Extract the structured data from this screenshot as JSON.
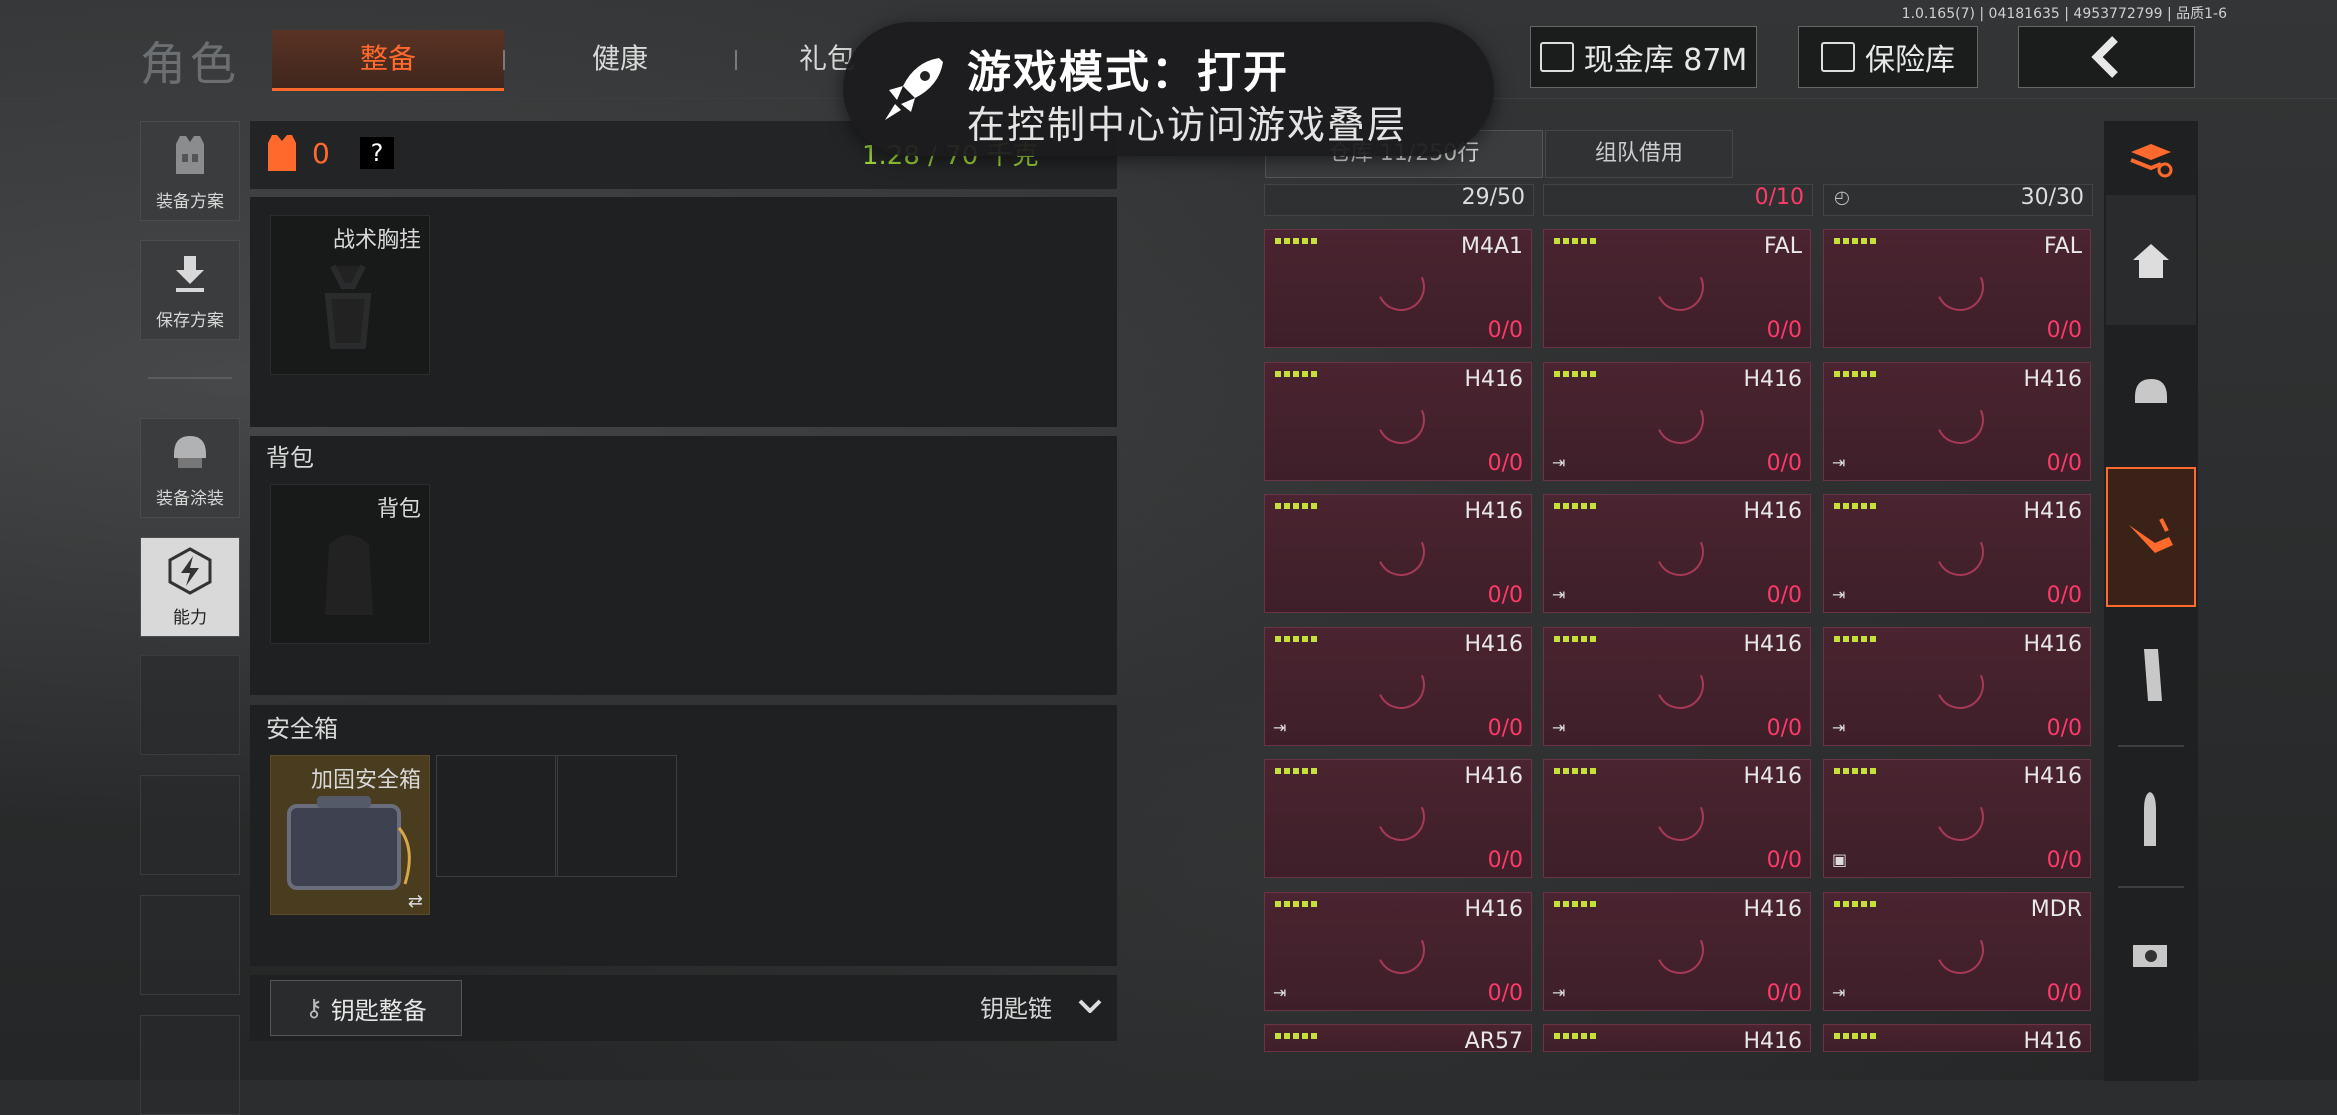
{
  "header": {
    "title": "角色",
    "tabs": [
      {
        "label": "整备",
        "active": true
      },
      {
        "label": "健康",
        "active": false
      },
      {
        "label": "礼包",
        "active": false
      }
    ],
    "version": "1.0.165(7) | 04181635 | 4953772799 | 品质1-6",
    "cash_label": "现金库 87M",
    "safe_label": "保险库",
    "back_icon": "chevron-left-icon"
  },
  "toast": {
    "title": "游戏模式：打开",
    "subtitle": "在控制中心访问游戏叠层",
    "icon": "rocket-icon"
  },
  "left_nav": [
    {
      "label": "装备方案",
      "icon": "vest-icon",
      "active": false
    },
    {
      "label": "保存方案",
      "icon": "download-icon",
      "active": false
    },
    {
      "label": "装备涂装",
      "icon": "helmet-icon",
      "active": false
    },
    {
      "label": "能力",
      "icon": "ability-icon",
      "active": true
    }
  ],
  "loadout": {
    "armor_count": "0",
    "help": "?",
    "weight": "1.28 / 70 千克",
    "chest_rig_label": "战术胸挂",
    "backpack_section": "背包",
    "backpack_slot": "背包",
    "safebox_section": "安全箱",
    "safebox_item": "加固安全箱",
    "keys_button": "钥匙整备",
    "keychain_label": "钥匙链"
  },
  "storage": {
    "tabs": [
      {
        "label": "仓库 11/250行",
        "active": true
      },
      {
        "label": "组队借用",
        "active": false
      }
    ],
    "top_row": [
      "29/50",
      "0/10",
      "30/30"
    ],
    "items": [
      {
        "name": "M4A1",
        "count": "0/0",
        "tag": ""
      },
      {
        "name": "FAL",
        "count": "0/0",
        "tag": ""
      },
      {
        "name": "FAL",
        "count": "0/0",
        "tag": ""
      },
      {
        "name": "H416",
        "count": "0/0",
        "tag": ""
      },
      {
        "name": "H416",
        "count": "0/0",
        "tag": "⇥"
      },
      {
        "name": "H416",
        "count": "0/0",
        "tag": "⇥"
      },
      {
        "name": "H416",
        "count": "0/0",
        "tag": ""
      },
      {
        "name": "H416",
        "count": "0/0",
        "tag": "⇥"
      },
      {
        "name": "H416",
        "count": "0/0",
        "tag": "⇥"
      },
      {
        "name": "H416",
        "count": "0/0",
        "tag": "⇥"
      },
      {
        "name": "H416",
        "count": "0/0",
        "tag": "⇥"
      },
      {
        "name": "H416",
        "count": "0/0",
        "tag": "⇥"
      },
      {
        "name": "H416",
        "count": "0/0",
        "tag": ""
      },
      {
        "name": "H416",
        "count": "0/0",
        "tag": ""
      },
      {
        "name": "H416",
        "count": "0/0",
        "tag": "▣"
      },
      {
        "name": "H416",
        "count": "0/0",
        "tag": "⇥"
      },
      {
        "name": "H416",
        "count": "0/0",
        "tag": "⇥"
      },
      {
        "name": "MDR",
        "count": "0/0",
        "tag": "⇥"
      },
      {
        "name": "AR57",
        "count": "",
        "tag": ""
      },
      {
        "name": "H416",
        "count": "",
        "tag": ""
      },
      {
        "name": "H416",
        "count": "",
        "tag": ""
      }
    ]
  },
  "right_nav": [
    "stack-icon",
    "home-icon",
    "helmet-icon",
    "rifle-icon",
    "magazine-icon",
    "bullet-icon",
    "sight-icon"
  ],
  "colors": {
    "accent": "#ff6a2c",
    "card": "#4a2430",
    "count": "#ff3a6a",
    "level": "#c6e03a"
  }
}
